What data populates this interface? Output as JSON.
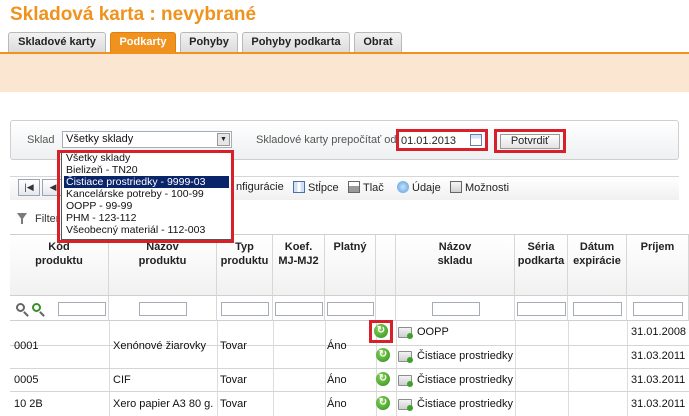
{
  "header": {
    "title": "Skladová karta :  nevybrané"
  },
  "tabs": [
    {
      "label": "Skladové karty",
      "active": false
    },
    {
      "label": "Podkarty",
      "active": true
    },
    {
      "label": "Pohyby",
      "active": false
    },
    {
      "label": "Pohyby podkarta",
      "active": false
    },
    {
      "label": "Obrat",
      "active": false
    }
  ],
  "filter": {
    "store_label": "Sklad",
    "store_selected": "Všetky sklady",
    "recalc_label": "Skladové karty prepočítať od",
    "date_value": "01.01.2013",
    "confirm_label": "Potvrdiť"
  },
  "dropdown": {
    "options": [
      "Všetky sklady",
      "Bielizeň - TN20",
      "Čistiace prostriedky - 9999-03",
      "Kancelárske potreby - 100-99",
      "OOPP - 99-99",
      "PHM - 123-112",
      "Všeobecný materiál - 112-003"
    ],
    "selected_index": 2
  },
  "toolbar": {
    "configuration_label": "nfigurácie",
    "columns_label": "Stĺpce",
    "print_label": "Tlač",
    "data_label": "Údaje",
    "options_label": "Možnosti",
    "filter_label": "Filter"
  },
  "grid": {
    "columns": [
      {
        "line1": "Kód",
        "line2": "produktu"
      },
      {
        "line1": "Názov",
        "line2": "produktu"
      },
      {
        "line1": "Typ",
        "line2": "produktu"
      },
      {
        "line1": "Koef.",
        "line2": "MJ-MJ2"
      },
      {
        "line1": "Platný",
        "line2": ""
      },
      {
        "line1": "Názov",
        "line2": "skladu"
      },
      {
        "line1": "Séria",
        "line2": "podkarta"
      },
      {
        "line1": "Dátum",
        "line2": "expirácie"
      },
      {
        "line1": "Príjem",
        "line2": ""
      }
    ],
    "rows": [
      {
        "code": "0001",
        "name": "Xenónové žiarovky",
        "type": "Tovar",
        "valid": "Áno",
        "sub": [
          {
            "store": "OOPP",
            "date": "31.01.2008"
          },
          {
            "store": "Čistiace prostriedky",
            "date": "31.03.2011"
          }
        ]
      },
      {
        "code": "0005",
        "name": "CIF",
        "type": "Tovar",
        "valid": "Áno",
        "sub": [
          {
            "store": "Čistiace prostriedky",
            "date": "31.03.2011"
          }
        ]
      },
      {
        "code": "10 2B",
        "name": "Xero papier A3 80 g.",
        "type": "Tovar",
        "valid": "Áno",
        "sub": [
          {
            "store": "Čistiace prostriedky",
            "date": "31.03.2011"
          }
        ]
      }
    ]
  },
  "colors": {
    "accent": "#f0921e",
    "highlight": "#d8202a",
    "selection": "#0a246a"
  }
}
